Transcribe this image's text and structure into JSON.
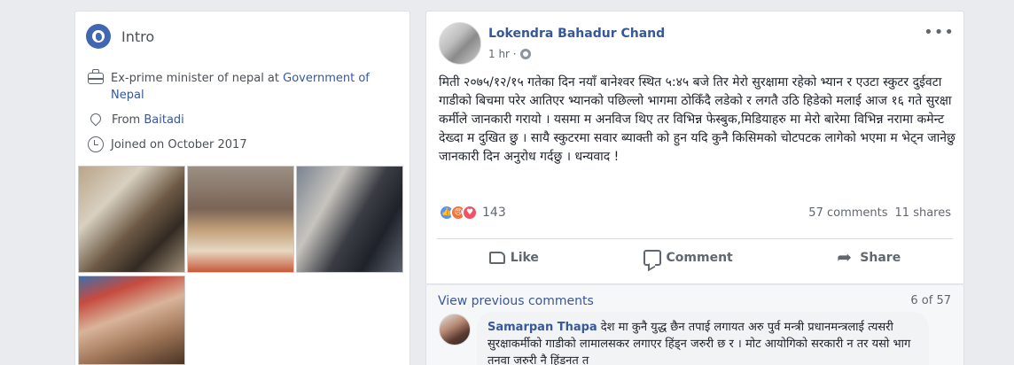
{
  "intro": {
    "title": "Intro",
    "work_prefix": "Ex-prime minister of nepal at ",
    "work_link": "Government of Nepal",
    "from_prefix": "From ",
    "from_link": "Baitadi",
    "joined": "Joined on October 2017",
    "icons": [
      "globe-icon",
      "briefcase-icon",
      "location-pin-icon",
      "clock-icon"
    ]
  },
  "post": {
    "author": "Lokendra Bahadur Chand",
    "time": "1 hr ·",
    "more": "•••",
    "text": "मिती २०७५/१२/१५ गतेका दिन नयाँ बानेश्वर स्थित ५:४५ बजे तिर मेरो सुरक्षामा रहेको भ्यान र एउटा स्कुटर दुईवटा गाडीको बिचमा परेर आतिएर भ्यानको पछिल्लो भागमा ठोकिँदै लडेको र लगतै उठि हिडेको मलाई आज १६ गते सुरक्षा कर्मीले जानकारी गरायो । यसमा म अनविज थिए तर विभिन्न फेस्बुक,मिडियाहरु मा मेरो बारेमा विभिन्न नरामा कमेन्ट देख्दा म दुखित छु । सायै स्कुटरमा सवार ब्याक्ती को हुन यदि कुनै किसिमको चोटपटक लागेको भएमा म भेट्न जानेछु जानकारी दिन अनुरोध गर्दछु । धन्यवाद !",
    "reaction_count": "143",
    "comments_count": "57 comments",
    "shares_count": "11 shares",
    "actions": {
      "like": "Like",
      "comment": "Comment",
      "share": "Share"
    }
  },
  "comments": {
    "view_previous": "View previous comments",
    "position": "6 of 57",
    "items": [
      {
        "name": "Samarpan Thapa",
        "text": "देश मा कुनै युद्ध छैन तपाई लगायत अरु पुर्व मन्त्री प्रधानमन्त्रलाई त्यसरी सुरक्षाकर्मीको गाडीको लामालसकर लगाएर हिंड्न जरुरी छ र । मोट आयोगिको सरकारी न तर यसो भाग तनवा जरुरी नै हिंडनत त"
      }
    ]
  },
  "colors": {
    "link": "#365899",
    "page_bg": "#e9ebee",
    "like": "#5890ff",
    "angry": "#f0743d",
    "love": "#f25268"
  }
}
